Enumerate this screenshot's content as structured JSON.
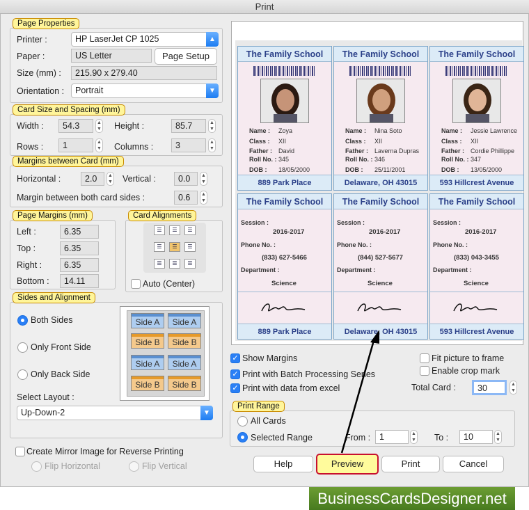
{
  "window": {
    "title": "Print"
  },
  "page_properties": {
    "label": "Page Properties",
    "printer_label": "Printer :",
    "printer": "HP LaserJet CP 1025",
    "paper_label": "Paper :",
    "paper": "US Letter",
    "page_setup": "Page Setup",
    "size_label": "Size (mm) :",
    "size": "215.90 x 279.40",
    "orientation_label": "Orientation :",
    "orientation": "Portrait"
  },
  "card_size": {
    "label": "Card Size and Spacing (mm)",
    "width_label": "Width :",
    "width": "54.3",
    "height_label": "Height :",
    "height": "85.7",
    "rows_label": "Rows :",
    "rows": "1",
    "columns_label": "Columns :",
    "columns": "3"
  },
  "margins_card": {
    "label": "Margins between Card (mm)",
    "horizontal_label": "Horizontal :",
    "horizontal": "2.0",
    "vertical_label": "Vertical :",
    "vertical": "0.0",
    "both_label": "Margin between both card sides :",
    "both": "0.6"
  },
  "page_margins": {
    "label": "Page Margins (mm)",
    "left_label": "Left :",
    "left": "6.35",
    "top_label": "Top :",
    "top": "6.35",
    "right_label": "Right :",
    "right": "6.35",
    "bottom_label": "Bottom :",
    "bottom": "14.11"
  },
  "card_alignments": {
    "label": "Card Alignments",
    "auto_label": "Auto (Center)"
  },
  "sides": {
    "label": "Sides and Alignment",
    "both": "Both Sides",
    "front": "Only Front Side",
    "back": "Only Back Side",
    "layout_label": "Select Layout :",
    "layout": "Up-Down-2",
    "side_a": "Side A",
    "side_b": "Side B",
    "mirror": "Create Mirror Image for Reverse Printing",
    "flip_h": "Flip Horizontal",
    "flip_v": "Flip Vertical"
  },
  "options": {
    "show_margins": "Show Margins",
    "batch": "Print with Batch Processing Series",
    "excel": "Print with data from excel",
    "fit": "Fit picture to frame",
    "crop": "Enable crop mark",
    "total_label": "Total Card :",
    "total": "30"
  },
  "print_range": {
    "label": "Print Range",
    "all": "All Cards",
    "selected": "Selected Range",
    "from_label": "From :",
    "from": "1",
    "to_label": "To :",
    "to": "10"
  },
  "buttons": {
    "help": "Help",
    "preview": "Preview",
    "print": "Print",
    "cancel": "Cancel"
  },
  "preview": {
    "front": [
      {
        "school": "The Family School",
        "name": "Zoya",
        "class": "XII",
        "father": "David",
        "roll": "345",
        "dob": "18/05/2000",
        "address": "889 Park Place"
      },
      {
        "school": "The Family School",
        "name": "Nina Soto",
        "class": "XII",
        "father": "Laverna Dupras",
        "roll": "346",
        "dob": "25/11/2001",
        "address": "Delaware, OH 43015"
      },
      {
        "school": "The Family School",
        "name": "Jessie Lawrence",
        "class": "XII",
        "father": "Cordie Phillippe",
        "roll": "347",
        "dob": "13/05/2000",
        "address": "593 Hillcrest Avenue"
      }
    ],
    "back": [
      {
        "school": "The Family School",
        "session": "2016-2017",
        "phone": "(833) 627-5466",
        "department": "Science",
        "address": "889 Park Place"
      },
      {
        "school": "The Family School",
        "session": "2016-2017",
        "phone": "(844) 527-5677",
        "department": "Science",
        "address": "Delaware, OH 43015"
      },
      {
        "school": "The Family School",
        "session": "2016-2017",
        "phone": "(833) 043-3455",
        "department": "Science",
        "address": "593 Hillcrest Avenue"
      }
    ],
    "field_labels": {
      "name": "Name :",
      "class": "Class :",
      "father": "Father :",
      "roll": "Roll No. :",
      "dob": "DOB :",
      "session": "Session :",
      "phone": "Phone No. :",
      "department": "Department :"
    }
  },
  "watermark": "BusinessCardsDesigner.net"
}
